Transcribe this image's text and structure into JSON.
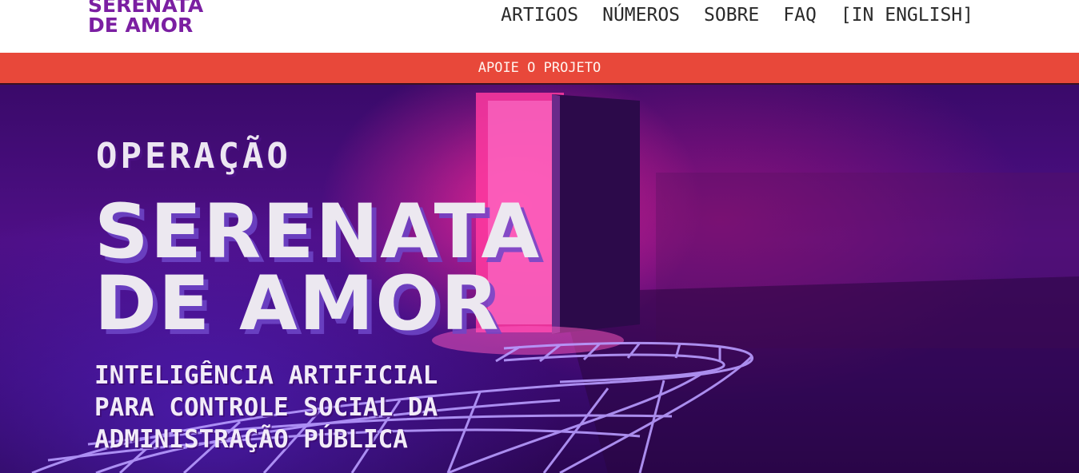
{
  "header": {
    "logo_line1": "SERENATA",
    "logo_line2": "DE AMOR",
    "nav": [
      {
        "label": "ARTIGOS"
      },
      {
        "label": "NÚMEROS"
      },
      {
        "label": "SOBRE"
      },
      {
        "label": "FAQ"
      },
      {
        "label": "[IN ENGLISH]"
      }
    ]
  },
  "support_bar": {
    "label": "APOIE O PROJETO"
  },
  "hero": {
    "kicker": "OPERAÇÃO",
    "title_line1": "SERENATA",
    "title_line2": "DE AMOR",
    "subtitle_lines": [
      "INTELIGÊNCIA ARTIFICIAL",
      "PARA CONTROLE SOCIAL DA",
      "ADMINISTRAÇÃO PÚBLICA"
    ]
  },
  "colors": {
    "brand_purple": "#7b1fa2",
    "support_red": "#e8483a",
    "hero_bg": "#4e0f86",
    "hero_text": "#ece8f0"
  }
}
